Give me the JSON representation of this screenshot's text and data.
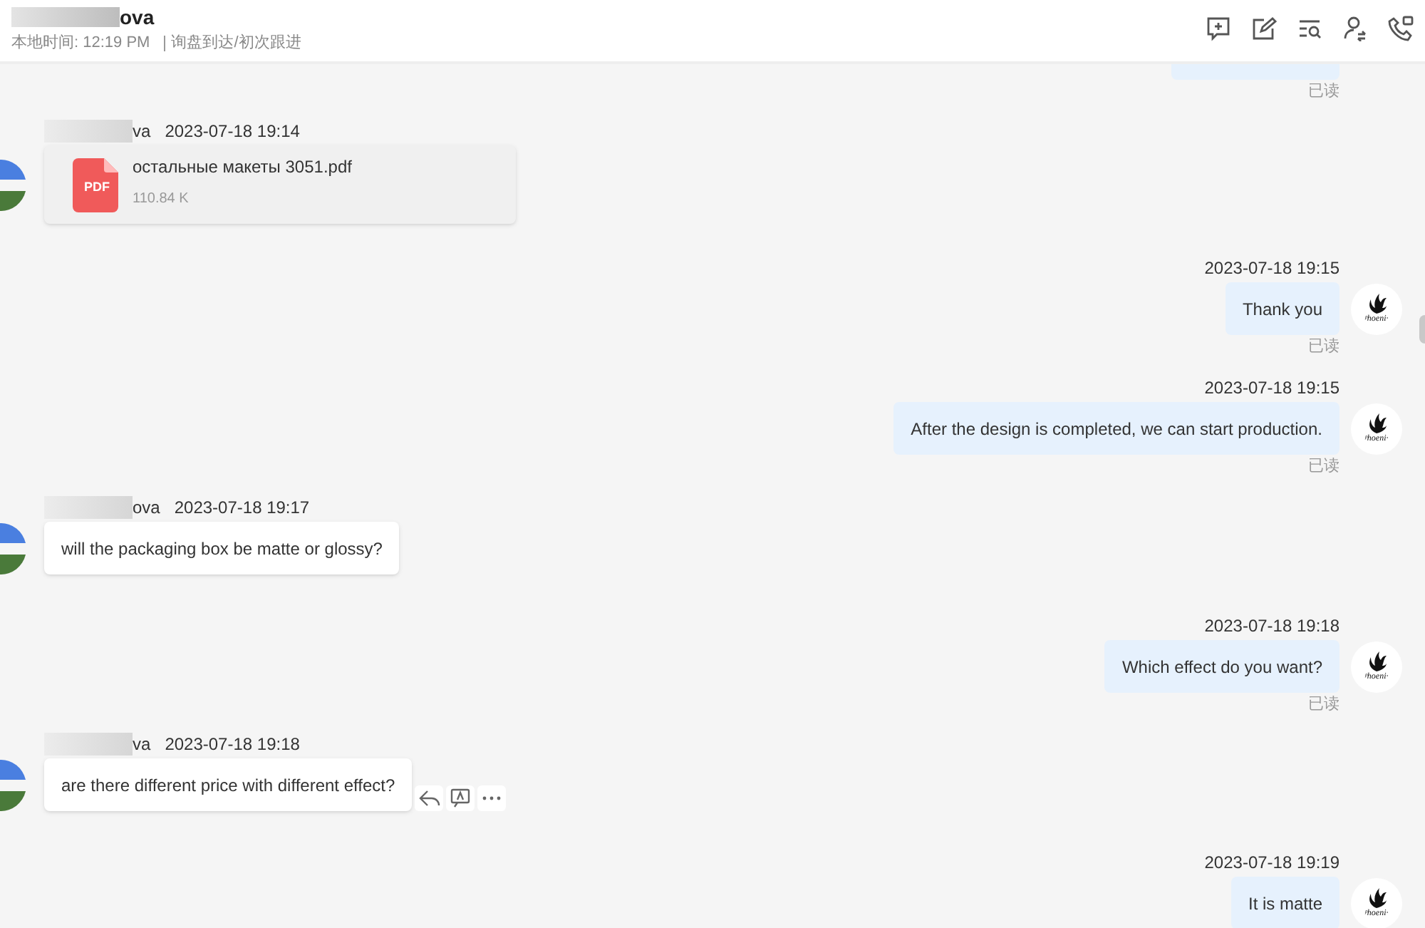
{
  "header": {
    "title": "ova",
    "local_time": "本地时间: 12:19 PM",
    "stage": "询盘到达/初次跟进"
  },
  "messages": [
    {
      "kind": "partial",
      "outgoing": true,
      "read": "已读"
    },
    {
      "kind": "file",
      "outgoing": false,
      "sender": "va",
      "time": "2023-07-18 19:14",
      "file_name": "остальные макеты 3051.pdf",
      "file_size": "110.84 K",
      "file_badge": "PDF"
    },
    {
      "kind": "text",
      "outgoing": true,
      "time": "2023-07-18 19:15",
      "text": "Thank you",
      "read": "已读",
      "avatar_label": "ᵖhoeni·"
    },
    {
      "kind": "text",
      "outgoing": true,
      "time": "2023-07-18 19:15",
      "text": "After the design is completed, we can start production.",
      "read": "已读",
      "avatar_label": "ᵖhoeni·"
    },
    {
      "kind": "text",
      "outgoing": false,
      "sender": "ova",
      "time": "2023-07-18 19:17",
      "text": "will the packaging box be matte or glossy?"
    },
    {
      "kind": "text",
      "outgoing": true,
      "time": "2023-07-18 19:18",
      "text": "Which effect do you want?",
      "read": "已读",
      "avatar_label": "ᵖhoeni·"
    },
    {
      "kind": "text",
      "outgoing": false,
      "sender": "va",
      "time": "2023-07-18 19:18",
      "text": "are there different price with different effect?",
      "hovered": true
    },
    {
      "kind": "text",
      "outgoing": true,
      "time": "2023-07-18 19:19",
      "text": "It is matte",
      "avatar_label": "ᵖhoeni·"
    }
  ]
}
